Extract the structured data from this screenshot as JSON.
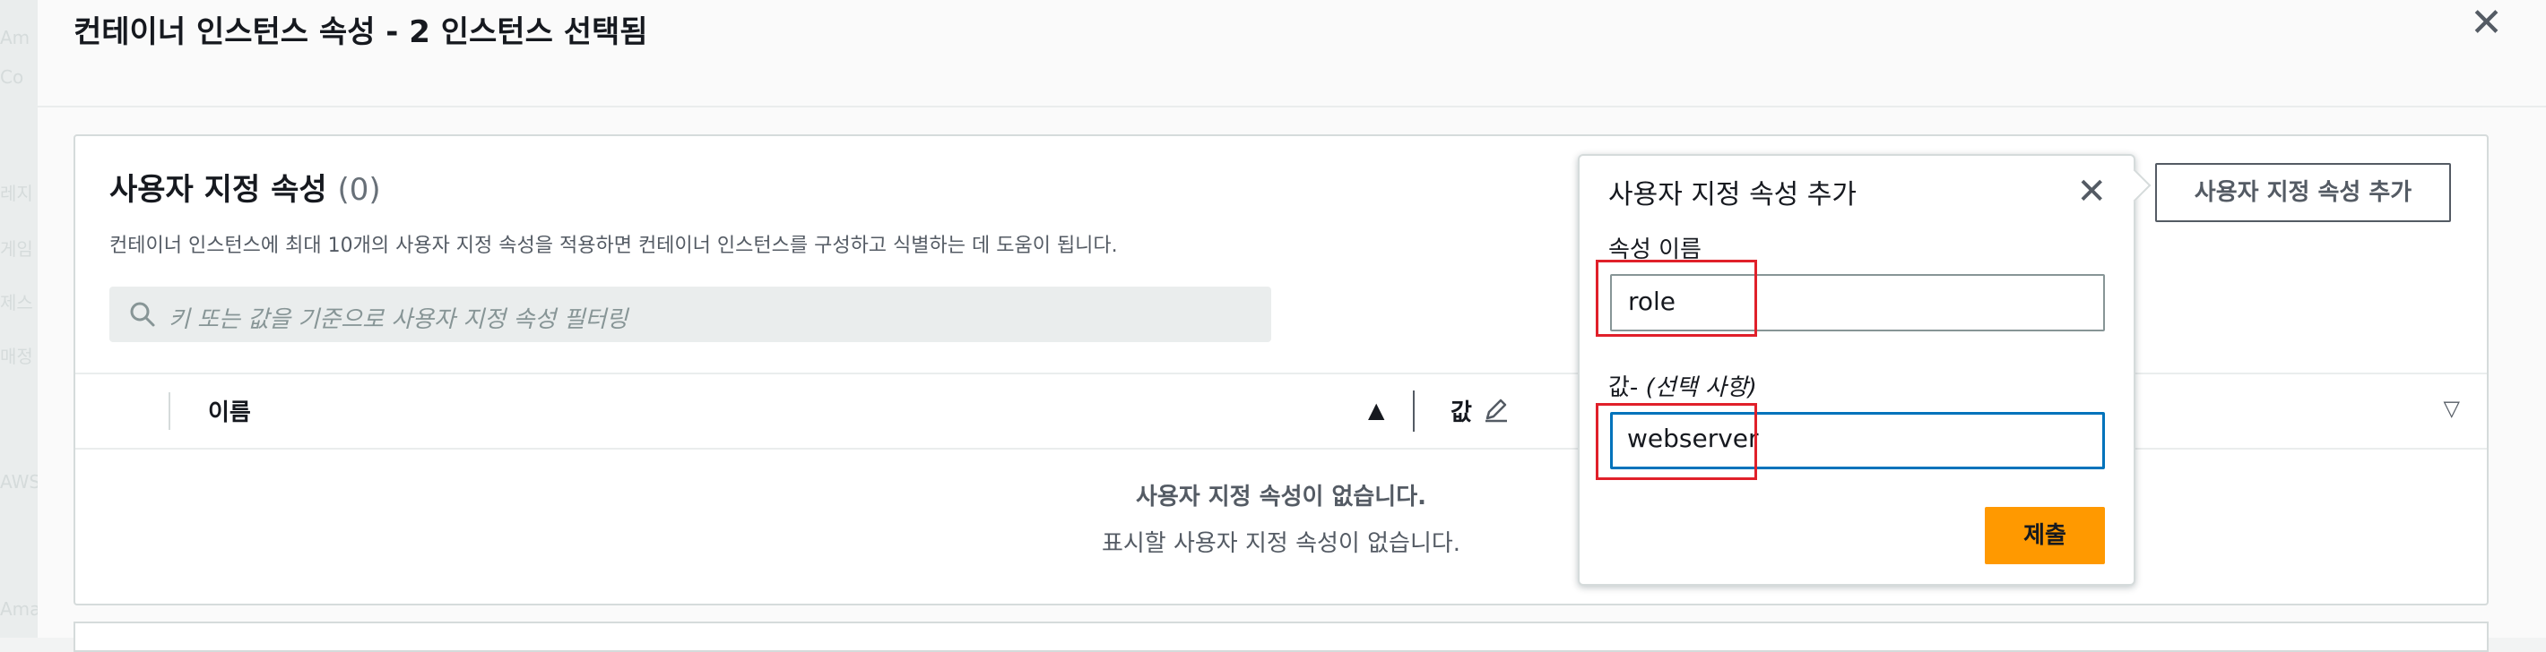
{
  "background": {
    "ghost_texts": [
      "Am",
      "Co",
      "레지",
      "게임",
      "제스",
      "매정",
      "AWS",
      "Ama"
    ]
  },
  "modal": {
    "title": "컨테이너 인스턴스 속성 - 2 인스턴스 선택됨"
  },
  "panel": {
    "title": "사용자 지정 속성",
    "count": "(0)",
    "description": "컨테이너 인스턴스에 최대 10개의 사용자 지정 속성을 적용하면 컨테이너 인스턴스를 구성하고 식별하는 데 도움이 됩니다.",
    "filter_placeholder": "키 또는 값을 기준으로 사용자 지정 속성 필터링",
    "add_button": "사용자 지정 속성 추가"
  },
  "table": {
    "columns": [
      {
        "label": "이름",
        "sort": "ascending"
      },
      {
        "label": "값",
        "editable": true
      }
    ],
    "empty_title": "사용자 지정 속성이 없습니다.",
    "empty_desc": "표시할 사용자 지정 속성이 없습니다."
  },
  "popover": {
    "title": "사용자 지정 속성 추가",
    "name_label": "속성 이름",
    "name_value": "role",
    "value_label": "값-",
    "value_label_hint": "(선택 사항)",
    "value_value": "webserver",
    "submit_label": "제출"
  },
  "colors": {
    "primary": "#ff9900",
    "focus": "#0073bb",
    "highlight": "#e0202a"
  }
}
